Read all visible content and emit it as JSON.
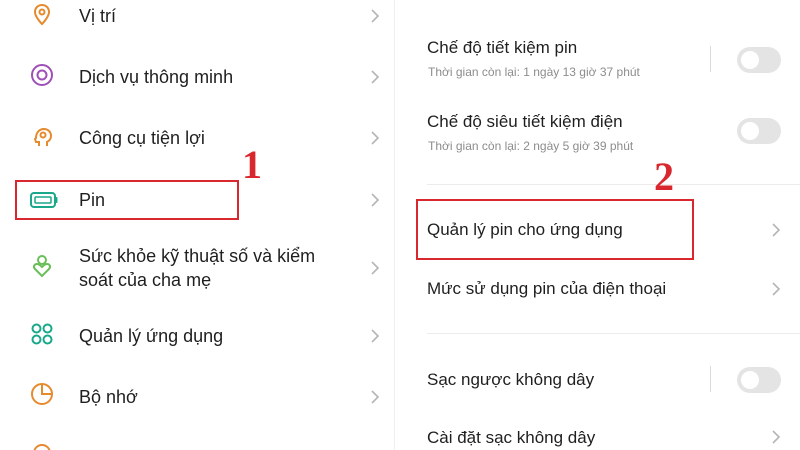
{
  "left_menu": {
    "items": [
      {
        "label": "Vị trí",
        "icon": "location-pin-icon"
      },
      {
        "label": "Dịch vụ thông minh",
        "icon": "smart-service-icon"
      },
      {
        "label": "Công cụ tiện lợi",
        "icon": "convenience-tools-icon"
      },
      {
        "label": "Pin",
        "icon": "battery-icon"
      },
      {
        "label_line1": "Sức khỏe kỹ thuật số và kiểm",
        "label_line2": "soát của cha mẹ",
        "icon": "digital-wellbeing-icon"
      },
      {
        "label": "Quản lý ứng dụng",
        "icon": "app-grid-icon"
      },
      {
        "label": "Bộ nhớ",
        "icon": "storage-pie-icon"
      }
    ]
  },
  "battery_settings": {
    "power_saving": {
      "title": "Chế độ tiết kiệm pin",
      "subtitle": "Thời gian còn lại:  1 ngày 13 giờ 37 phút",
      "enabled": false
    },
    "super_power_saving": {
      "title": "Chế độ siêu tiết kiệm điện",
      "subtitle": "Thời gian còn lại:  2 ngày 5 giờ 39 phút",
      "enabled": false
    },
    "app_battery_management": {
      "title": "Quản lý pin cho ứng dụng"
    },
    "phone_battery_usage": {
      "title": "Mức sử dụng pin của điện thoại"
    },
    "reverse_wireless_charging": {
      "title": "Sạc ngược không dây",
      "enabled": false
    },
    "wireless_charging_settings": {
      "title": "Cài đặt sạc không dây"
    }
  },
  "annotations": {
    "step1": "1",
    "step2": "2",
    "color": "#d9272e"
  },
  "colors": {
    "accent_teal": "#1aa88a",
    "accent_purple": "#a04fb8",
    "accent_orange": "#e68a2e",
    "accent_green": "#6bbf59",
    "accent_blue": "#3b8fd4",
    "text_primary": "#1f1f1f",
    "text_secondary": "#8c8c8c",
    "toggle_off": "#e4e4e4"
  }
}
